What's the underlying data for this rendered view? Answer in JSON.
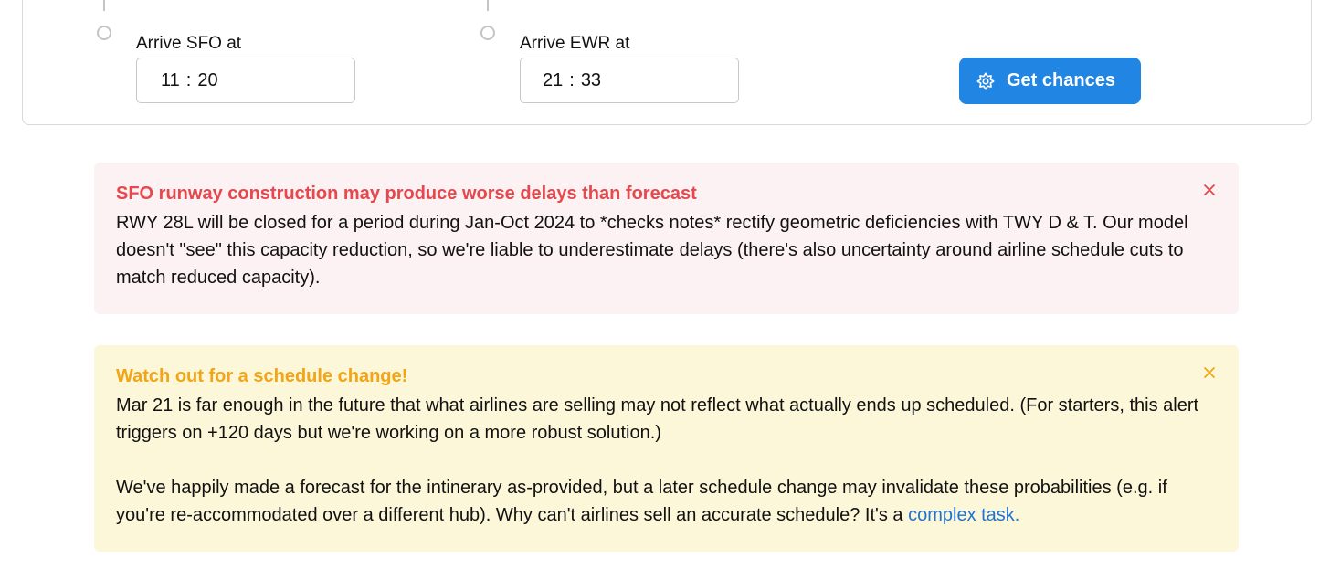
{
  "form": {
    "arrive_sfo_label": "Arrive SFO at",
    "arrive_sfo_hour": "11",
    "arrive_sfo_minute": "20",
    "arrive_ewr_label": "Arrive EWR at",
    "arrive_ewr_hour": "21",
    "arrive_ewr_minute": "33",
    "time_separator": ":",
    "get_chances_label": "Get chances",
    "get_chances_icon": "ai-sparkle-icon"
  },
  "alerts": [
    {
      "type": "danger",
      "title": "SFO runway construction may produce worse delays than forecast",
      "body": "RWY 28L will be closed for a period during Jan-Oct 2024 to *checks notes* rectify geometric deficiencies with TWY D & T. Our model doesn't \"see\" this capacity reduction, so we're liable to underestimate delays (there's also uncertainty around airline schedule cuts to match reduced capacity)."
    },
    {
      "type": "warning",
      "title": "Watch out for a schedule change!",
      "body": "Mar 21 is far enough in the future that what airlines are selling may not reflect what actually ends up scheduled. (For starters, this alert triggers on +120 days but we're working on a more robust solution.)",
      "body2": "We've happily made a forecast for the intinerary as-provided, but a later schedule change may invalidate these probabilities (e.g. if you're re-accommodated over a different hub). Why can't airlines sell an accurate schedule? It's a",
      "link_text": "complex task."
    }
  ],
  "colors": {
    "primary": "#2185e3",
    "danger": "#e5484d",
    "danger_bg": "#fdf2f3",
    "warning": "#f2a516",
    "warning_bg": "#fdf7d9",
    "link": "#1e72d6"
  }
}
